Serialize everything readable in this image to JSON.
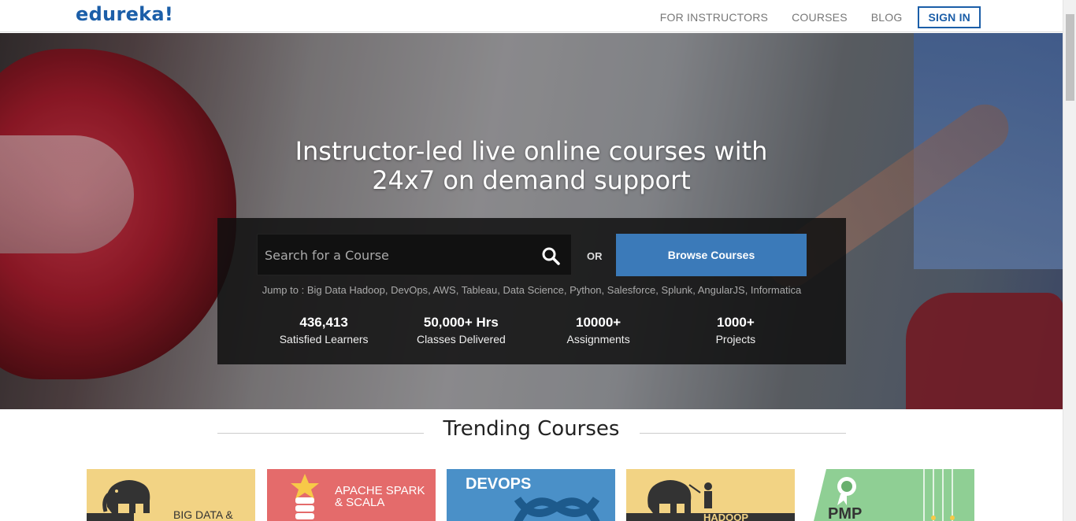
{
  "header": {
    "logo": "edureka!",
    "nav": [
      "FOR INSTRUCTORS",
      "COURSES",
      "BLOG"
    ],
    "signin": "SIGN IN"
  },
  "hero": {
    "headline_line1": "Instructor-led live online courses with",
    "headline_line2": "24x7 on demand support",
    "search_placeholder": "Search for a Course",
    "or": "OR",
    "browse": "Browse Courses",
    "jump_prefix": "Jump to :",
    "jump_links": [
      "Big Data Hadoop",
      "DevOps",
      "AWS",
      "Tableau",
      "Data Science",
      "Python",
      "Salesforce",
      "Splunk",
      "AngularJS",
      "Informatica"
    ],
    "stats": [
      {
        "num": "436,413",
        "label": "Satisfied Learners"
      },
      {
        "num": "50,000+ Hrs",
        "label": "Classes Delivered"
      },
      {
        "num": "10000+",
        "label": "Assignments"
      },
      {
        "num": "1000+",
        "label": "Projects"
      }
    ]
  },
  "trending": {
    "title": "Trending Courses",
    "cards": [
      {
        "text": "BIG DATA &",
        "bg": "#f2d384"
      },
      {
        "text": "APACHE SPARK & SCALA",
        "bg": "#e46b6b"
      },
      {
        "text": "DEVOPS",
        "bg": "#4a90c8"
      },
      {
        "text": "HADOOP",
        "bg": "#f2d384"
      },
      {
        "text": "PMP",
        "bg": "#8fcf94"
      }
    ]
  },
  "colors": {
    "brand": "#1b5ea8",
    "browse": "#3b7ab9"
  }
}
